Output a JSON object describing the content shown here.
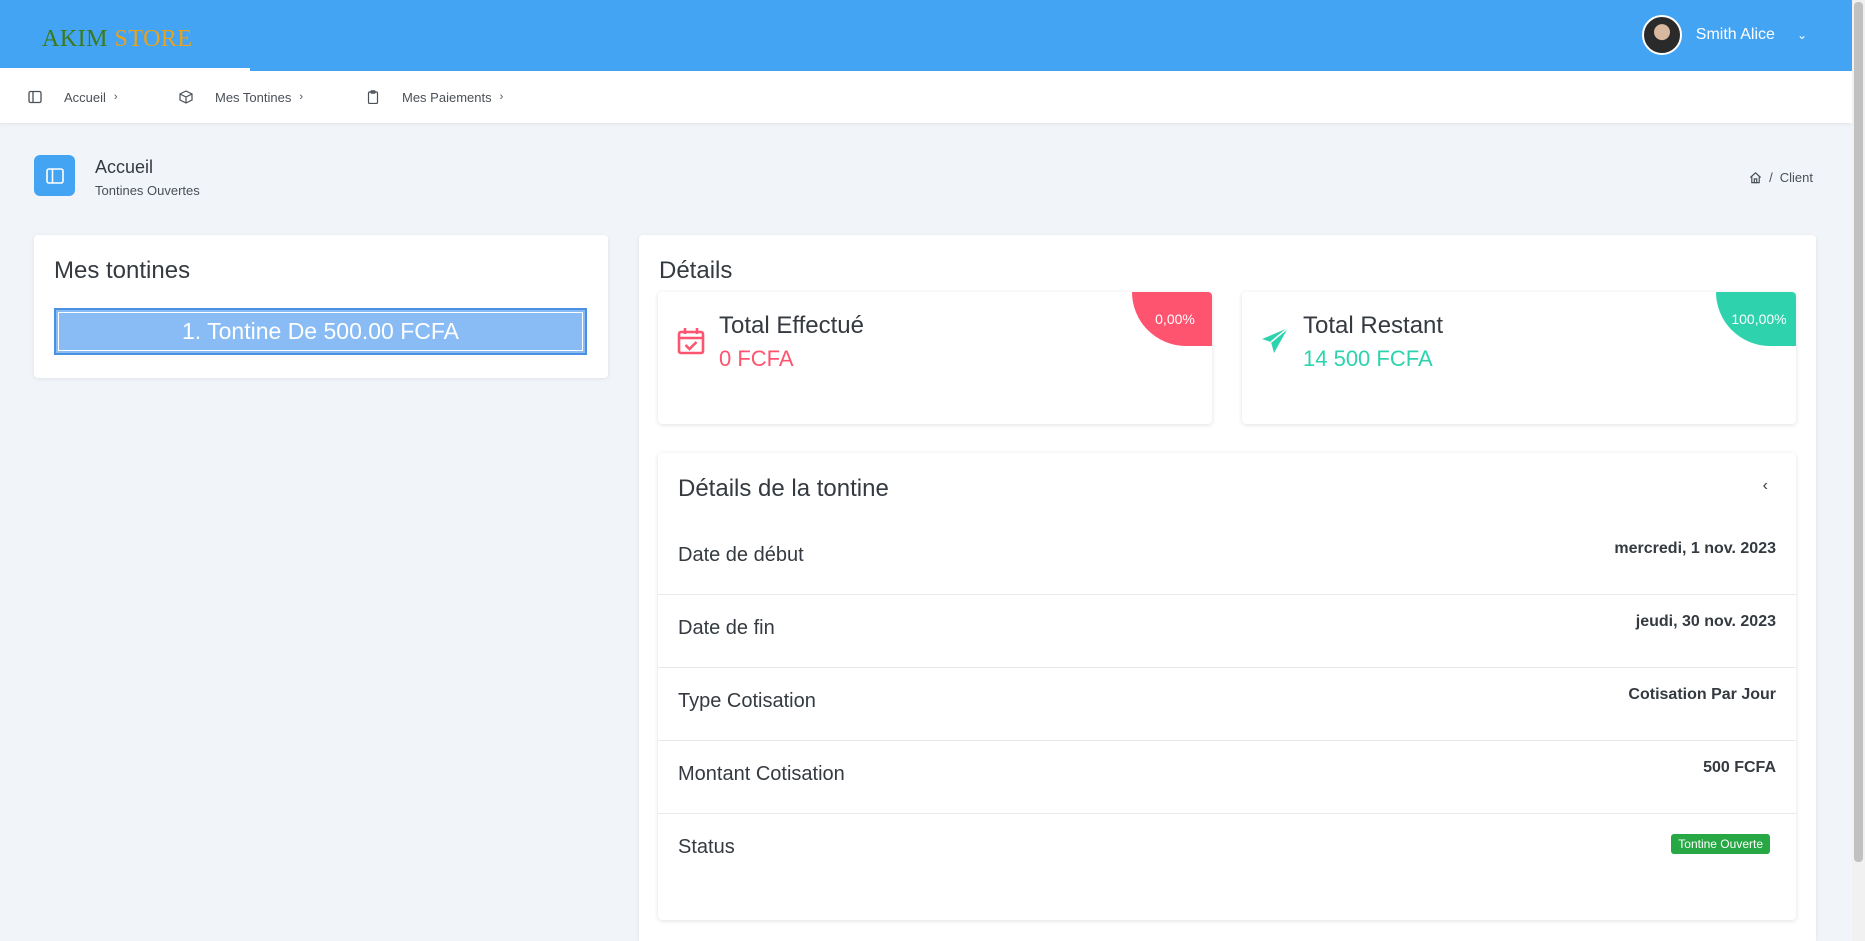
{
  "brand": {
    "part1": "AKIM",
    "part2": "STORE"
  },
  "user": {
    "name": "Smith Alice"
  },
  "nav": [
    {
      "label": "Accueil"
    },
    {
      "label": "Mes Tontines"
    },
    {
      "label": "Mes Paiements"
    }
  ],
  "page": {
    "title": "Accueil",
    "subtitle": "Tontines Ouvertes"
  },
  "breadcrumb": {
    "current": "Client"
  },
  "tontines": {
    "title": "Mes tontines",
    "items": [
      {
        "label": "1. Tontine De 500.00 FCFA"
      }
    ]
  },
  "details": {
    "title": "Détails",
    "stats": [
      {
        "title": "Total Effectué",
        "value": "0 FCFA",
        "percent": "0,00%",
        "color": "#ff5470"
      },
      {
        "title": "Total Restant",
        "value": "14 500 FCFA",
        "percent": "100,00%",
        "color": "#2ed3ad"
      }
    ],
    "tontine": {
      "title": "Détails de la tontine",
      "rows": [
        {
          "label": "Date de début",
          "value": "mercredi, 1 nov. 2023"
        },
        {
          "label": "Date de fin",
          "value": "jeudi, 30 nov. 2023"
        },
        {
          "label": "Type Cotisation",
          "value": "Cotisation Par Jour"
        },
        {
          "label": "Montant Cotisation",
          "value": "500 FCFA"
        },
        {
          "label": "Status",
          "value": "Tontine Ouverte"
        }
      ]
    }
  },
  "colors": {
    "primary": "#44a4f4",
    "success": "#28a745",
    "danger": "#ff5470",
    "teal": "#2ed3ad"
  }
}
